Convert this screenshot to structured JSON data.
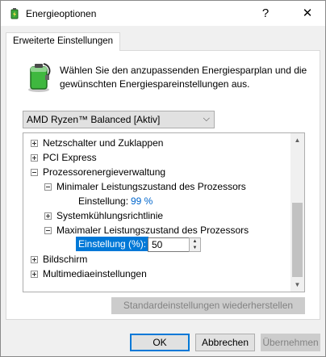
{
  "window": {
    "title": "Energieoptionen",
    "help_glyph": "?",
    "close_glyph": "✕"
  },
  "tab": {
    "label": "Erweiterte Einstellungen"
  },
  "description": "Wählen Sie den anzupassenden Energiesparplan und die gewünschten Energiespareinstellungen aus.",
  "plan_select": {
    "value": "AMD Ryzen™ Balanced [Aktiv]"
  },
  "tree": {
    "items": [
      {
        "label": "Netzschalter und Zuklappen",
        "state": "collapsed"
      },
      {
        "label": "PCI Express",
        "state": "collapsed"
      },
      {
        "label": "Prozessorenergieverwaltung",
        "state": "expanded"
      },
      {
        "label": "Minimaler Leistungszustand des Prozessors",
        "state": "expanded"
      },
      {
        "label": "Einstellung:",
        "value": "99 %"
      },
      {
        "label": "Systemkühlungsrichtlinie",
        "state": "collapsed"
      },
      {
        "label": "Maximaler Leistungszustand des Prozessors",
        "state": "expanded"
      },
      {
        "label": "Einstellung (%):",
        "value": "50"
      },
      {
        "label": "Bildschirm",
        "state": "collapsed"
      },
      {
        "label": "Multimediaeinstellungen",
        "state": "collapsed"
      }
    ]
  },
  "restore_button": {
    "label": "Standardeinstellungen wiederherstellen"
  },
  "footer": {
    "ok_label": "OK",
    "cancel_label": "Abbrechen",
    "apply_label": "Übernehmen"
  },
  "colors": {
    "accent": "#0078d7",
    "value_link": "#0066cc",
    "disabled_text": "#838383"
  }
}
